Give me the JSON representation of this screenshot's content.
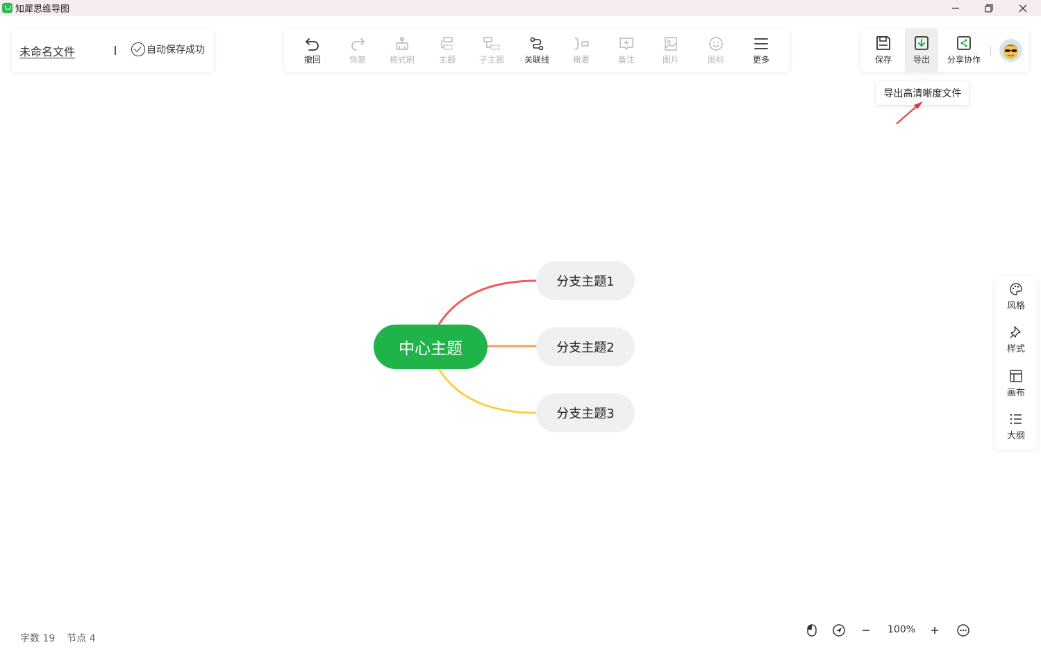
{
  "app": {
    "title": "知犀思维导图"
  },
  "file": {
    "name": "未命名文件",
    "save_status": "自动保存成功"
  },
  "toolbar": {
    "undo": "撤回",
    "redo": "恢复",
    "format_painter": "格式刷",
    "topic": "主题",
    "subtopic": "子主题",
    "relation_line": "关联线",
    "summary": "概要",
    "note": "备注",
    "image": "图片",
    "icon": "图标",
    "more": "更多"
  },
  "actions": {
    "save": "保存",
    "export": "导出",
    "share": "分享协作"
  },
  "tooltip": {
    "text": "导出高清晰度文件"
  },
  "mindmap": {
    "center": "中心主题",
    "branches": [
      "分支主题1",
      "分支主题2",
      "分支主题3"
    ],
    "branch_colors": [
      "#ef5b5b",
      "#f5a05a",
      "#f7cf4a"
    ],
    "center_color": "#1fb34a"
  },
  "side_panel": {
    "style_theme": "风格",
    "style": "样式",
    "canvas": "画布",
    "outline": "大纲"
  },
  "status": {
    "word_count_label": "字数",
    "word_count": "19",
    "node_count_label": "节点",
    "node_count": "4"
  },
  "zoom": {
    "value": "100%"
  },
  "colors": {
    "accent": "#1fb34a",
    "annotation_arrow": "#e8333a"
  }
}
